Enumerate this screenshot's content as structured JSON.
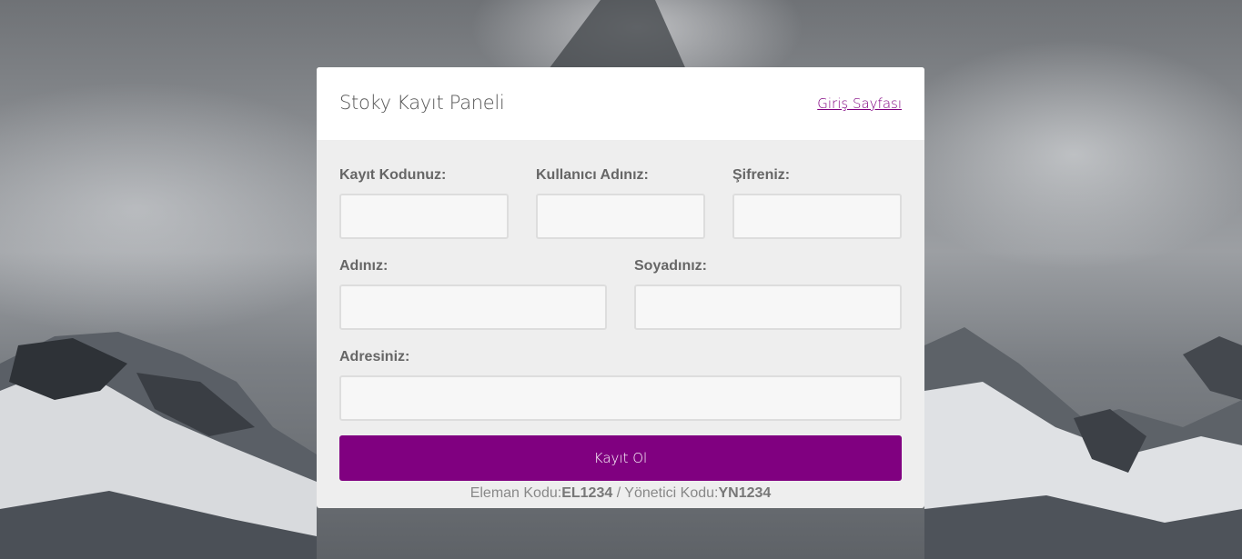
{
  "panel": {
    "title": "Stoky Kayıt Paneli",
    "login_link": "Giriş Sayfası"
  },
  "form": {
    "fields": [
      {
        "label": "Kayıt Kodunuz:",
        "value": "",
        "placeholder": ""
      },
      {
        "label": "Kullanıcı Adınız:",
        "value": "",
        "placeholder": ""
      },
      {
        "label": "Şifreniz:",
        "value": "",
        "placeholder": ""
      },
      {
        "label": "Adınız:",
        "value": "",
        "placeholder": ""
      },
      {
        "label": "Soyadınız:",
        "value": "",
        "placeholder": ""
      },
      {
        "label": "Adresiniz:",
        "value": "",
        "placeholder": ""
      }
    ],
    "submit_label": "Kayıt Ol"
  },
  "codes": {
    "staff_label": "Eleman Kodu:",
    "staff_code": "EL1234",
    "separator": " / ",
    "admin_label": "Yönetici Kodu:",
    "admin_code": "YN1234"
  },
  "colors": {
    "accent": "#800080",
    "panel_body": "#eeeeee"
  }
}
